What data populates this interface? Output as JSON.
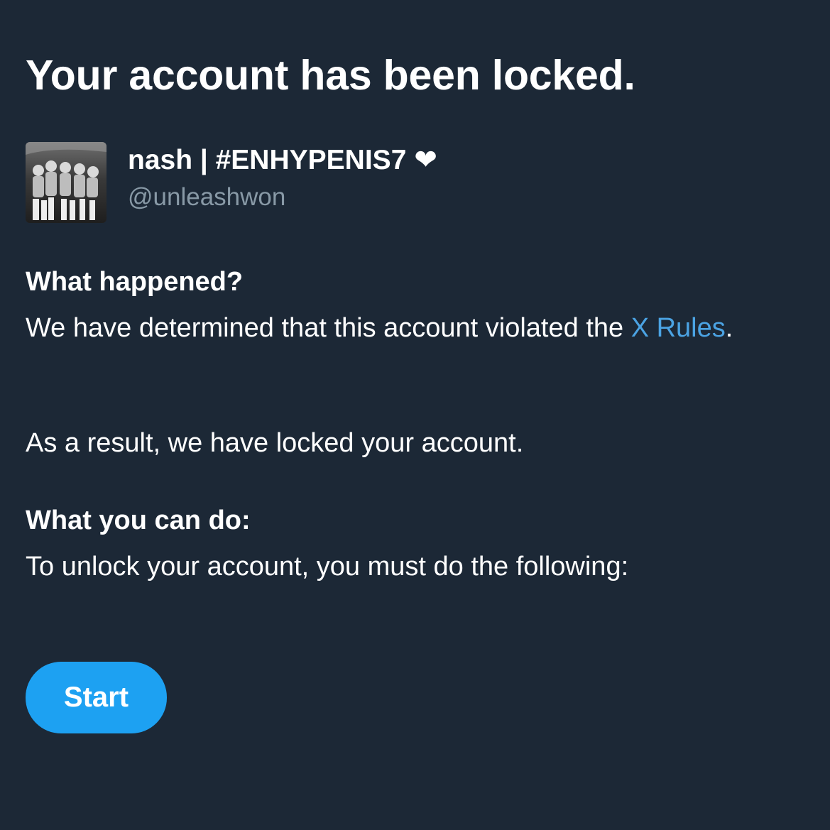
{
  "page": {
    "title": "Your account has been locked."
  },
  "profile": {
    "display_name": "nash | #ENHYPENIS7 ❤",
    "handle": "@unleashwon"
  },
  "what_happened": {
    "heading": "What happened?",
    "text_before_link": "We have determined that this account violated the ",
    "link_text": "X Rules",
    "text_after_link": ".",
    "result_text": "As a result, we have locked your account."
  },
  "what_you_can_do": {
    "heading": "What you can do:",
    "text": "To unlock your account, you must do the following:"
  },
  "actions": {
    "start_label": "Start"
  },
  "colors": {
    "background": "#1c2836",
    "link": "#4ba3e3",
    "button": "#1da1f2",
    "secondary_text": "#8899a6"
  }
}
